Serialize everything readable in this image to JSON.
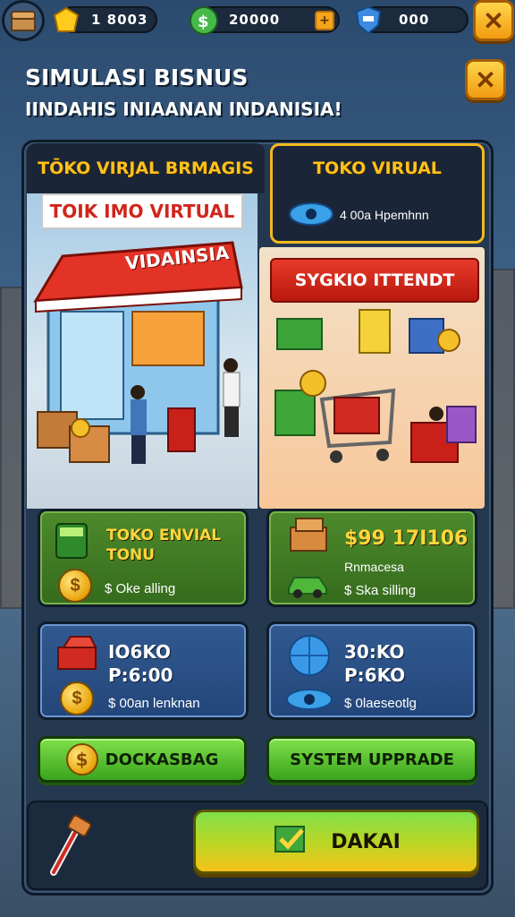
{
  "resources": [
    {
      "icon": "gold-gem-icon",
      "value": "1 8003"
    },
    {
      "icon": "cash-money-icon",
      "value": "20000"
    },
    {
      "icon": "shield-badge-icon",
      "value": "000"
    }
  ],
  "header": {
    "title": "SIMULASI BISNUS",
    "subtitle": "IINDAHIS INIAANAN INDANISIA!"
  },
  "cards": {
    "left": {
      "header": "TŌKO VIRJAL BRMAGIS",
      "sign": "TOIK IMO VIRTUAL",
      "awning": "VIDAINSIA"
    },
    "right": {
      "header": "TOKO VIRUAL",
      "subtext": "4 00a Hpemhnn",
      "sign": "SYGKIO ITTENDT"
    }
  },
  "stats": [
    {
      "line1": "TOKO ENVIAL",
      "line2": "TONU",
      "sub": "$ Oke alling",
      "theme": "green"
    },
    {
      "line1": "$99 17I106",
      "line2": "",
      "label": "Rnmacesa",
      "sub": "$ Ska silling",
      "theme": "green"
    },
    {
      "line1": "IO6KO",
      "line2": "P:6:00",
      "sub": "$ 00an lenknan",
      "theme": "blue"
    },
    {
      "line1": "30:KO",
      "line2": "P:6KO",
      "sub": "$ 0laeseotlg",
      "theme": "blue"
    }
  ],
  "buttons": {
    "left": "DOCKASBAG",
    "right": "SYSTEM UPPRADE",
    "main": "DAKAI"
  },
  "colors": {
    "accent_yellow": "#ffc21a",
    "button_green": "#3aa41c",
    "panel_bg": "#24384f"
  }
}
